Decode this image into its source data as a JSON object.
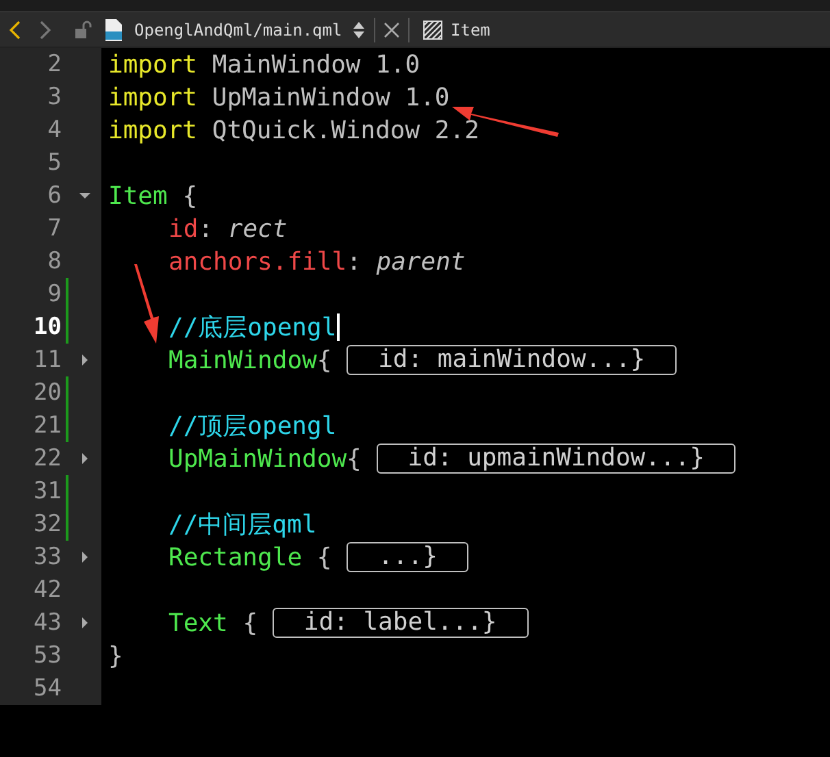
{
  "toolbar": {
    "back_enabled": true,
    "forward_enabled": false,
    "file_name": "OpenglAndQml/main.qml",
    "symbol": "Item"
  },
  "lines": [
    {
      "number": "2",
      "changed": false,
      "current": false,
      "tokens": [
        {
          "text": "import",
          "kind": "keyword"
        },
        {
          "text": " MainWindow 1.0",
          "kind": "plain"
        }
      ]
    },
    {
      "number": "3",
      "changed": false,
      "current": false,
      "tokens": [
        {
          "text": "import",
          "kind": "keyword"
        },
        {
          "text": " UpMainWindow 1.0",
          "kind": "plain"
        }
      ]
    },
    {
      "number": "4",
      "changed": false,
      "current": false,
      "tokens": [
        {
          "text": "import",
          "kind": "keyword"
        },
        {
          "text": " QtQuick.Window 2.2",
          "kind": "plain"
        }
      ]
    },
    {
      "number": "5",
      "changed": false,
      "current": false
    },
    {
      "number": "6",
      "changed": false,
      "current": false,
      "expanded": true,
      "tokens": [
        {
          "text": "Item",
          "kind": "type"
        },
        {
          "text": " {",
          "kind": "plain"
        }
      ],
      "children": [
        {
          "number": "7",
          "changed": false,
          "current": false,
          "tokens": [
            {
              "text": "id",
              "kind": "property"
            },
            {
              "text": ": ",
              "kind": "plain"
            },
            {
              "text": "rect",
              "kind": "value"
            }
          ]
        },
        {
          "number": "8",
          "changed": false,
          "current": false,
          "tokens": [
            {
              "text": "anchors.fill",
              "kind": "property"
            },
            {
              "text": ": ",
              "kind": "plain"
            },
            {
              "text": "parent",
              "kind": "value"
            }
          ]
        },
        {
          "number": "9",
          "changed": true,
          "current": false
        },
        {
          "number": "10",
          "changed": true,
          "current": true,
          "tokens": [
            {
              "text": "//底层opengl",
              "kind": "comment"
            }
          ]
        },
        {
          "number": "11",
          "changed": false,
          "current": false,
          "expanded": false,
          "tokens": [
            {
              "text": "MainWindow",
              "kind": "type"
            },
            {
              "text": "{ ",
              "kind": "plain"
            },
            {
              "text": "id: mainWindow...}",
              "kind": "folded"
            }
          ]
        },
        {
          "number": "20",
          "changed": true,
          "current": false
        },
        {
          "number": "21",
          "changed": true,
          "current": false,
          "tokens": [
            {
              "text": "//顶层opengl",
              "kind": "comment"
            }
          ]
        },
        {
          "number": "22",
          "changed": false,
          "current": false,
          "expanded": false,
          "tokens": [
            {
              "text": "UpMainWindow",
              "kind": "type"
            },
            {
              "text": "{ ",
              "kind": "plain"
            },
            {
              "text": "id: upmainWindow...}",
              "kind": "folded"
            }
          ]
        },
        {
          "number": "31",
          "changed": true,
          "current": false
        },
        {
          "number": "32",
          "changed": true,
          "current": false,
          "tokens": [
            {
              "text": "//中间层qml",
              "kind": "comment"
            }
          ]
        },
        {
          "number": "33",
          "changed": false,
          "current": false,
          "expanded": false,
          "tokens": [
            {
              "text": "Rectangle",
              "kind": "type"
            },
            {
              "text": " { ",
              "kind": "plain"
            },
            {
              "text": "...}",
              "kind": "folded"
            }
          ]
        },
        {
          "number": "42",
          "changed": false,
          "current": false
        },
        {
          "number": "43",
          "changed": false,
          "current": false,
          "expanded": false,
          "tokens": [
            {
              "text": "Text",
              "kind": "type"
            },
            {
              "text": " { ",
              "kind": "plain"
            },
            {
              "text": "id: label...}",
              "kind": "folded"
            }
          ]
        }
      ]
    },
    {
      "number": "53",
      "changed": false,
      "current": false,
      "tokens": [
        {
          "text": "}",
          "kind": "plain"
        }
      ]
    },
    {
      "number": "54",
      "changed": false,
      "current": false
    }
  ]
}
